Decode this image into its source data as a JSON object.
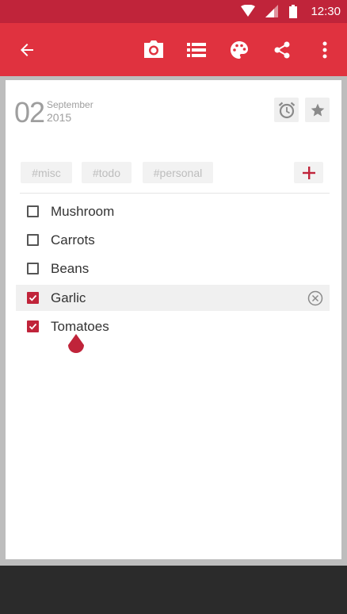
{
  "status_bar": {
    "time": "12:30"
  },
  "app_bar": {
    "icons": [
      "back-arrow-icon",
      "camera-icon",
      "list-icon",
      "palette-icon",
      "share-icon",
      "more-vert-icon"
    ],
    "color": "#e0323f"
  },
  "note": {
    "date": {
      "day": "02",
      "month": "September",
      "year": "2015"
    },
    "tags": [
      "#misc",
      "#todo",
      "#personal"
    ],
    "items": [
      {
        "label": "Mushroom",
        "checked": false
      },
      {
        "label": "Carrots",
        "checked": false
      },
      {
        "label": "Beans",
        "checked": false
      },
      {
        "label": "Garlic",
        "checked": true
      },
      {
        "label": "Tomatoes",
        "checked": true
      }
    ]
  },
  "colors": {
    "accent": "#c0243a",
    "appbar": "#e0323f"
  }
}
